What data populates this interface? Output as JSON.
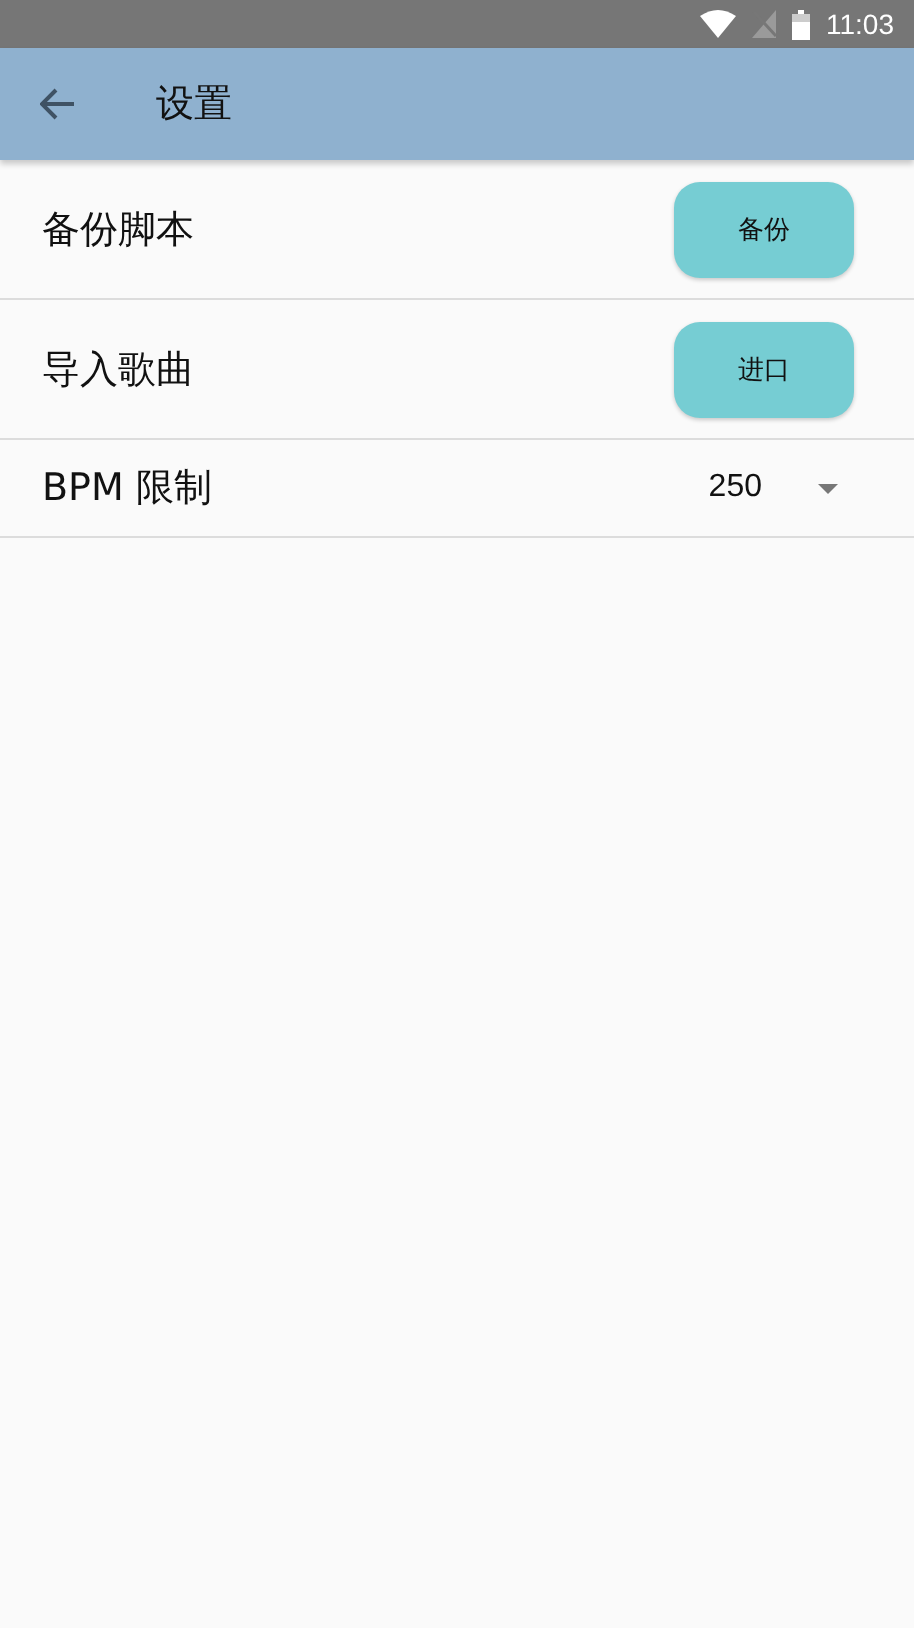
{
  "status_bar": {
    "time": "11:03"
  },
  "app_bar": {
    "title": "设置"
  },
  "settings": [
    {
      "kind": "button",
      "label": "备份脚本",
      "button": "备份"
    },
    {
      "kind": "button",
      "label": "导入歌曲",
      "button": "进口"
    },
    {
      "kind": "dropdown",
      "label": "BPM 限制",
      "value": "250"
    }
  ]
}
